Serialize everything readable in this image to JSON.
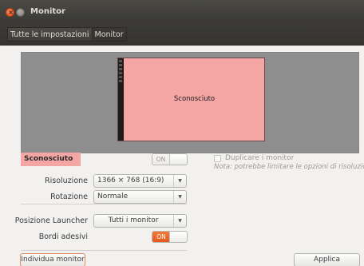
{
  "window": {
    "title": "Monitor",
    "close_glyph": "×",
    "controls": [
      "close-icon",
      "minimize-icon"
    ]
  },
  "breadcrumb": {
    "items": [
      "Tutte le impostazioni",
      "Monitor"
    ]
  },
  "preview": {
    "monitor_label": "Sconosciuto"
  },
  "display": {
    "name": "Sconosciuto",
    "power_toggle": "ON",
    "mirror_label": "Duplicare i monitor",
    "mirror_note": "Nota: potrebbe limitare le opzioni di risoluzione"
  },
  "settings": {
    "resolution_label": "Risoluzione",
    "resolution_value": "1366 × 768 (16:9)",
    "rotation_label": "Rotazione",
    "rotation_value": "Normale",
    "launcher_label": "Posizione Launcher",
    "launcher_value": "Tutti i monitor",
    "sticky_label": "Bordi adesivi",
    "sticky_toggle": "ON"
  },
  "actions": {
    "detect": "Individua monitor",
    "apply": "Applica"
  },
  "colors": {
    "monitor_fill": "#f4a6a4",
    "accent_orange": "#e2581c",
    "titlebar": "#3c3b37"
  },
  "icons": {
    "dropdown": "▼"
  }
}
